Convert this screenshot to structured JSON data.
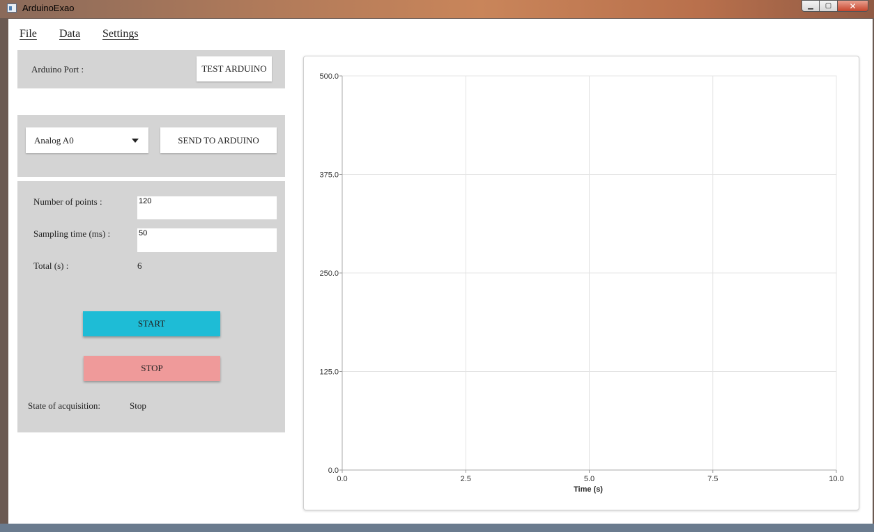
{
  "window": {
    "title": "ArduinoExao"
  },
  "menu": {
    "items": [
      "File",
      "Data",
      "Settings"
    ]
  },
  "port_panel": {
    "label": "Arduino Port :",
    "test_button": "TEST ARDUINO"
  },
  "channel_panel": {
    "selected_channel": "Analog A0",
    "send_button": "SEND TO ARDUINO"
  },
  "acquisition": {
    "points_label": "Number of points :",
    "points_value": "120",
    "sampling_label": "Sampling time (ms) :",
    "sampling_value": "50",
    "total_label": "Total (s) :",
    "total_value": "6",
    "start_button": "START",
    "stop_button": "STOP",
    "state_label": "State of acquisition:",
    "state_value": "Stop"
  },
  "colors": {
    "start": "#1ebcd6",
    "stop": "#ef9a9a",
    "panel": "#d4d4d4",
    "accent": "#00bcd4"
  },
  "chart_data": {
    "type": "line",
    "title": "",
    "xlabel": "Time (s)",
    "ylabel": "",
    "xlim": [
      0,
      10
    ],
    "ylim": [
      0,
      500
    ],
    "x_ticks": [
      "0.0",
      "2.5",
      "5.0",
      "7.5",
      "10.0"
    ],
    "y_ticks": [
      "0.0",
      "125.0",
      "250.0",
      "375.0",
      "500.0"
    ],
    "x_tick_values": [
      0,
      2.5,
      5,
      7.5,
      10
    ],
    "y_tick_values": [
      0,
      125,
      250,
      375,
      500
    ],
    "grid": true,
    "series": []
  }
}
